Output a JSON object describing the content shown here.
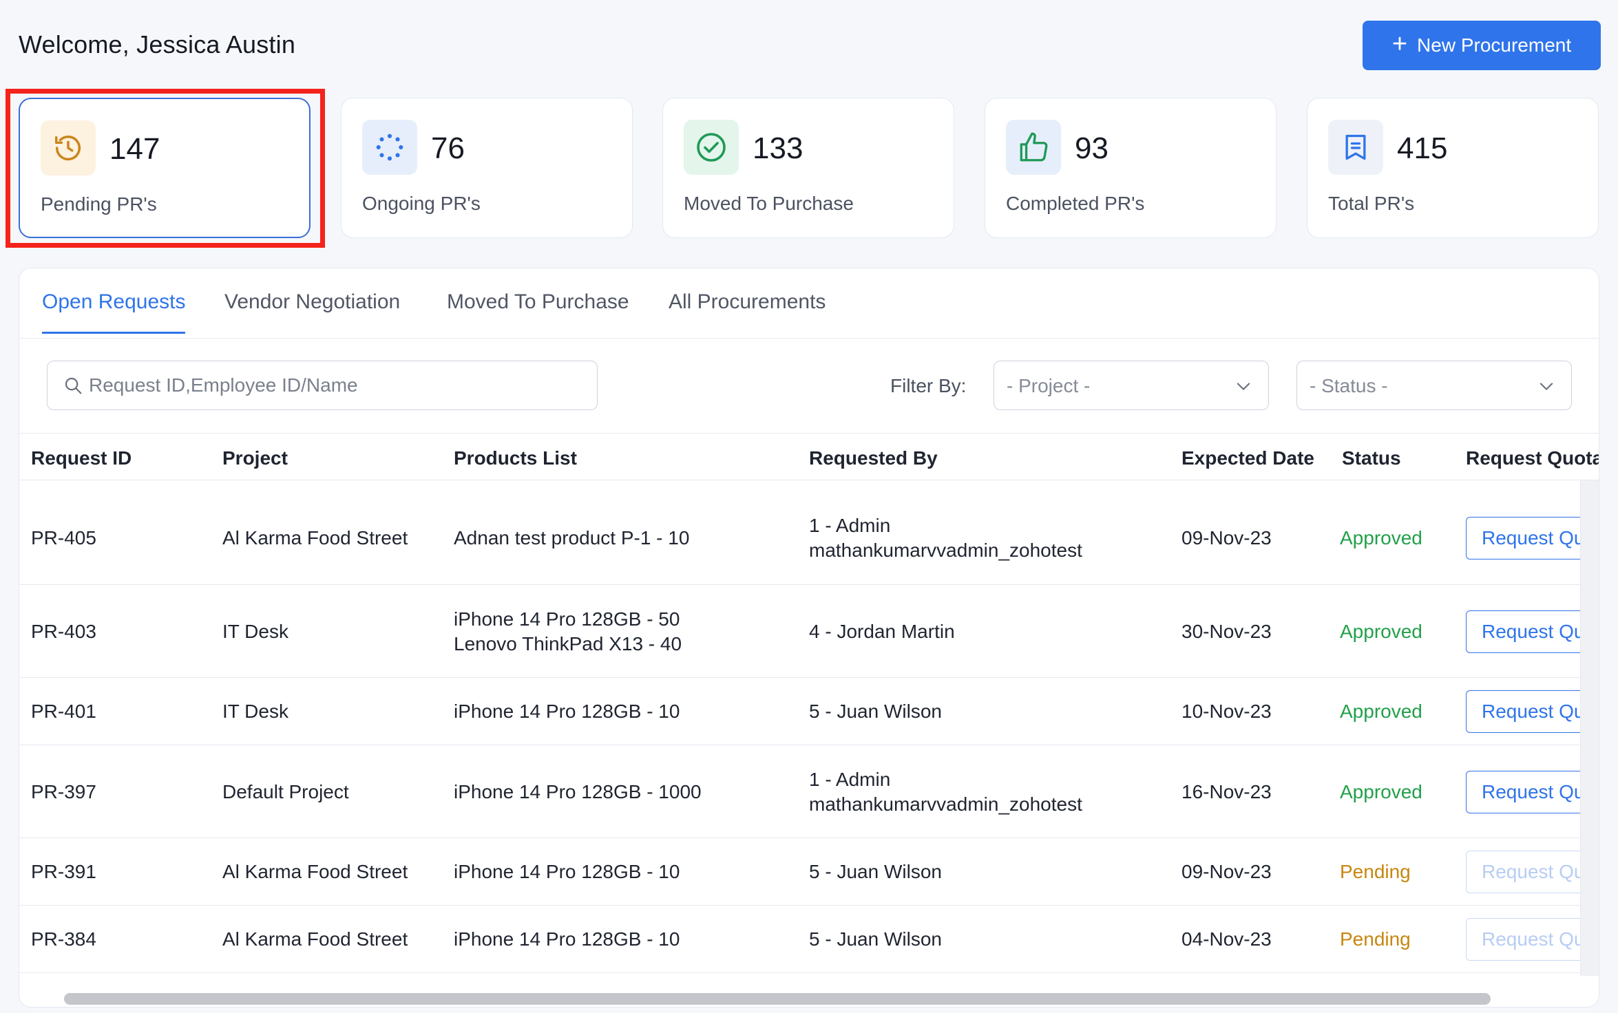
{
  "header": {
    "welcome": "Welcome, Jessica Austin",
    "new_button": "New Procurement"
  },
  "cards": [
    {
      "count": "147",
      "label": "Pending PR's",
      "icon": "history-icon",
      "color": "#c9861a"
    },
    {
      "count": "76",
      "label": "Ongoing PR's",
      "icon": "loading-dots-icon",
      "color": "#2f74ea"
    },
    {
      "count": "133",
      "label": "Moved To Purchase",
      "icon": "check-circle-icon",
      "color": "#1f9a57"
    },
    {
      "count": "93",
      "label": "Completed PR's",
      "icon": "thumbs-up-icon",
      "color": "#2f74ea"
    },
    {
      "count": "415",
      "label": "Total PR's",
      "icon": "receipt-icon",
      "color": "#2f74ea"
    }
  ],
  "tabs": [
    "Open Requests",
    "Vendor Negotiation",
    "Moved To Purchase",
    "All Procurements"
  ],
  "filters": {
    "search_placeholder": "Request ID,Employee ID/Name",
    "filter_label": "Filter By:",
    "project": "- Project -",
    "status": "- Status -"
  },
  "table": {
    "columns": [
      "Request ID",
      "Project",
      "Products List",
      "Requested By",
      "Expected Date",
      "Status",
      "Request Quotat"
    ],
    "rows": [
      {
        "id": "PR-405",
        "project": "Al Karma Food Street",
        "products": [
          "Adnan test product P-1 - 10"
        ],
        "requested_by": [
          "1 - Admin",
          "mathankumarvvadmin_zohotest"
        ],
        "date": "09-Nov-23",
        "status": "Approved",
        "action": "Request Qu"
      },
      {
        "id": "PR-403",
        "project": "IT Desk",
        "products": [
          "iPhone 14 Pro 128GB - 50",
          "Lenovo ThinkPad X13 - 40"
        ],
        "requested_by": [
          "4 - Jordan Martin"
        ],
        "date": "30-Nov-23",
        "status": "Approved",
        "action": "Request Qu"
      },
      {
        "id": "PR-401",
        "project": "IT Desk",
        "products": [
          "iPhone 14 Pro 128GB - 10"
        ],
        "requested_by": [
          "5 - Juan Wilson"
        ],
        "date": "10-Nov-23",
        "status": "Approved",
        "action": "Request Qu"
      },
      {
        "id": "PR-397",
        "project": "Default Project",
        "products": [
          "iPhone 14 Pro 128GB - 1000"
        ],
        "requested_by": [
          "1 - Admin",
          "mathankumarvvadmin_zohotest"
        ],
        "date": "16-Nov-23",
        "status": "Approved",
        "action": "Request Qu"
      },
      {
        "id": "PR-391",
        "project": "Al Karma Food Street",
        "products": [
          "iPhone 14 Pro 128GB - 10"
        ],
        "requested_by": [
          "5 - Juan Wilson"
        ],
        "date": "09-Nov-23",
        "status": "Pending",
        "action": "Request Qu"
      },
      {
        "id": "PR-384",
        "project": "Al Karma Food Street",
        "products": [
          "iPhone 14 Pro 128GB - 10"
        ],
        "requested_by": [
          "5 - Juan Wilson"
        ],
        "date": "04-Nov-23",
        "status": "Pending",
        "action": "Request Qu"
      }
    ]
  },
  "colors": {
    "accent": "#2f74ea",
    "approved": "#22a04a",
    "pending": "#c8860f",
    "highlight": "#f4231b"
  }
}
